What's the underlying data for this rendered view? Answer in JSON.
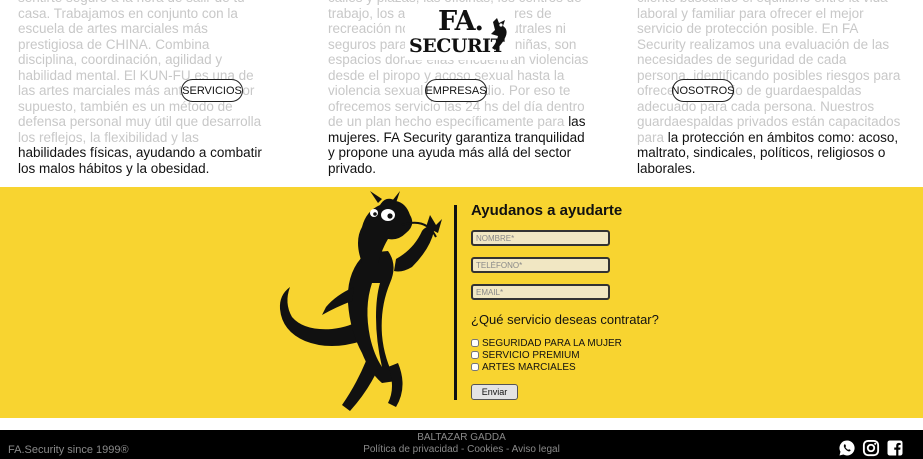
{
  "columns": [
    {
      "faded_text": "sentirte seguro a la hora de salir de tu casa. Trabajamos en conjunto con la escuela de artes marciales más prestigiosa de CHINA. Combina disciplina, coordinación, agilidad y habilidad mental. El KUN-FU es una de las artes marciales más antiguas.... Por supuesto, también es un método de defensa personal muy útil que desarrolla los reflejos, la flexibilidad y las",
      "visible_text": "habilidades físicas, ayudando a combatir los malos hábitos y la obesidad.",
      "button": "SERVICIOS"
    },
    {
      "faded_text": "calles y plazas, las oficinas, los centros de trabajo, los autobuses, los lugares de recreación no son espacios neutrales ni seguros para las mujeres y las niñas, son espacios donde ellas encuentran violencias desde el piropo y acoso sexual hasta la violencia sexual y feminicidio. Por eso te ofrecemos servicio las 24 hs del día dentro de un plan hecho específicamente para",
      "visible_text": "las mujeres. FA Security garantiza tranquilidad y propone una ayuda más allá del sector privado.",
      "button": "EMPRESAS"
    },
    {
      "faded_text": "cliente buscando el equilibrio entre la vida laboral y familiar para ofrecer el mejor servicio de protección posible. En FA Security realizamos una evaluación de las necesidades de seguridad de cada persona, identificando posibles riesgos para ofrecer el servicio de guardaespaldas adecuado para cada persona. Nuestros guardaespaldas privados están capacitados para",
      "visible_text": "la protección en ámbitos como: acoso, maltrato, sindicales, políticos, religiosos o laborales.",
      "button": "NOSOTROS"
    }
  ],
  "logo": {
    "line1": "FA.",
    "line2": "SECURIT"
  },
  "form": {
    "title": "Ayudanos a ayudarte",
    "placeholders": {
      "name": "NOMBRE*",
      "phone": "TELÉFONO*",
      "email": "EMAIL*"
    },
    "question": "¿Qué servicio deseas contratar?",
    "options": [
      "SEGURIDAD PARA LA MUJER",
      "SERVICIO PREMIUM",
      "ARTES MARCIALES"
    ],
    "submit": "Enviar"
  },
  "footer": {
    "copyright": "FA.Security since 1999®",
    "owner": "BALTAZAR GADDA",
    "links": [
      "Política de privacidad",
      "Cookies",
      "Aviso legal"
    ],
    "separator": " - ",
    "social_icons": [
      "whatsapp-icon",
      "instagram-icon",
      "facebook-icon"
    ]
  },
  "colors": {
    "band": "#f8d430",
    "footer": "#000000",
    "faded_text": "#c8c8c8"
  }
}
